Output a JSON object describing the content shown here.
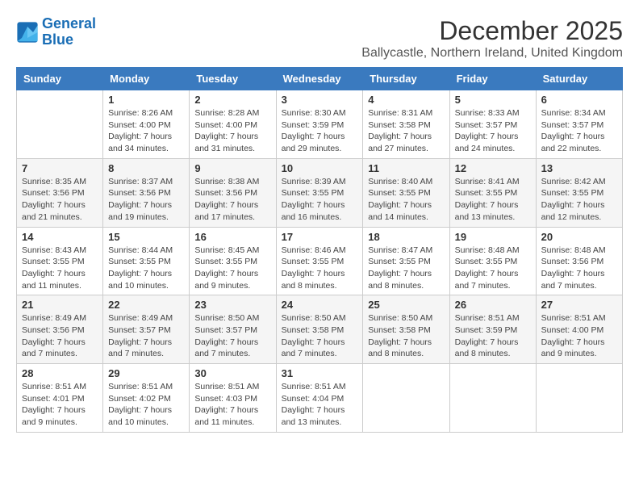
{
  "logo": {
    "line1": "General",
    "line2": "Blue"
  },
  "title": "December 2025",
  "location": "Ballycastle, Northern Ireland, United Kingdom",
  "days_of_week": [
    "Sunday",
    "Monday",
    "Tuesday",
    "Wednesday",
    "Thursday",
    "Friday",
    "Saturday"
  ],
  "weeks": [
    [
      {
        "day": "",
        "sunrise": "",
        "sunset": "",
        "daylight": ""
      },
      {
        "day": "1",
        "sunrise": "Sunrise: 8:26 AM",
        "sunset": "Sunset: 4:00 PM",
        "daylight": "Daylight: 7 hours and 34 minutes."
      },
      {
        "day": "2",
        "sunrise": "Sunrise: 8:28 AM",
        "sunset": "Sunset: 4:00 PM",
        "daylight": "Daylight: 7 hours and 31 minutes."
      },
      {
        "day": "3",
        "sunrise": "Sunrise: 8:30 AM",
        "sunset": "Sunset: 3:59 PM",
        "daylight": "Daylight: 7 hours and 29 minutes."
      },
      {
        "day": "4",
        "sunrise": "Sunrise: 8:31 AM",
        "sunset": "Sunset: 3:58 PM",
        "daylight": "Daylight: 7 hours and 27 minutes."
      },
      {
        "day": "5",
        "sunrise": "Sunrise: 8:33 AM",
        "sunset": "Sunset: 3:57 PM",
        "daylight": "Daylight: 7 hours and 24 minutes."
      },
      {
        "day": "6",
        "sunrise": "Sunrise: 8:34 AM",
        "sunset": "Sunset: 3:57 PM",
        "daylight": "Daylight: 7 hours and 22 minutes."
      }
    ],
    [
      {
        "day": "7",
        "sunrise": "Sunrise: 8:35 AM",
        "sunset": "Sunset: 3:56 PM",
        "daylight": "Daylight: 7 hours and 21 minutes."
      },
      {
        "day": "8",
        "sunrise": "Sunrise: 8:37 AM",
        "sunset": "Sunset: 3:56 PM",
        "daylight": "Daylight: 7 hours and 19 minutes."
      },
      {
        "day": "9",
        "sunrise": "Sunrise: 8:38 AM",
        "sunset": "Sunset: 3:56 PM",
        "daylight": "Daylight: 7 hours and 17 minutes."
      },
      {
        "day": "10",
        "sunrise": "Sunrise: 8:39 AM",
        "sunset": "Sunset: 3:55 PM",
        "daylight": "Daylight: 7 hours and 16 minutes."
      },
      {
        "day": "11",
        "sunrise": "Sunrise: 8:40 AM",
        "sunset": "Sunset: 3:55 PM",
        "daylight": "Daylight: 7 hours and 14 minutes."
      },
      {
        "day": "12",
        "sunrise": "Sunrise: 8:41 AM",
        "sunset": "Sunset: 3:55 PM",
        "daylight": "Daylight: 7 hours and 13 minutes."
      },
      {
        "day": "13",
        "sunrise": "Sunrise: 8:42 AM",
        "sunset": "Sunset: 3:55 PM",
        "daylight": "Daylight: 7 hours and 12 minutes."
      }
    ],
    [
      {
        "day": "14",
        "sunrise": "Sunrise: 8:43 AM",
        "sunset": "Sunset: 3:55 PM",
        "daylight": "Daylight: 7 hours and 11 minutes."
      },
      {
        "day": "15",
        "sunrise": "Sunrise: 8:44 AM",
        "sunset": "Sunset: 3:55 PM",
        "daylight": "Daylight: 7 hours and 10 minutes."
      },
      {
        "day": "16",
        "sunrise": "Sunrise: 8:45 AM",
        "sunset": "Sunset: 3:55 PM",
        "daylight": "Daylight: 7 hours and 9 minutes."
      },
      {
        "day": "17",
        "sunrise": "Sunrise: 8:46 AM",
        "sunset": "Sunset: 3:55 PM",
        "daylight": "Daylight: 7 hours and 8 minutes."
      },
      {
        "day": "18",
        "sunrise": "Sunrise: 8:47 AM",
        "sunset": "Sunset: 3:55 PM",
        "daylight": "Daylight: 7 hours and 8 minutes."
      },
      {
        "day": "19",
        "sunrise": "Sunrise: 8:48 AM",
        "sunset": "Sunset: 3:55 PM",
        "daylight": "Daylight: 7 hours and 7 minutes."
      },
      {
        "day": "20",
        "sunrise": "Sunrise: 8:48 AM",
        "sunset": "Sunset: 3:56 PM",
        "daylight": "Daylight: 7 hours and 7 minutes."
      }
    ],
    [
      {
        "day": "21",
        "sunrise": "Sunrise: 8:49 AM",
        "sunset": "Sunset: 3:56 PM",
        "daylight": "Daylight: 7 hours and 7 minutes."
      },
      {
        "day": "22",
        "sunrise": "Sunrise: 8:49 AM",
        "sunset": "Sunset: 3:57 PM",
        "daylight": "Daylight: 7 hours and 7 minutes."
      },
      {
        "day": "23",
        "sunrise": "Sunrise: 8:50 AM",
        "sunset": "Sunset: 3:57 PM",
        "daylight": "Daylight: 7 hours and 7 minutes."
      },
      {
        "day": "24",
        "sunrise": "Sunrise: 8:50 AM",
        "sunset": "Sunset: 3:58 PM",
        "daylight": "Daylight: 7 hours and 7 minutes."
      },
      {
        "day": "25",
        "sunrise": "Sunrise: 8:50 AM",
        "sunset": "Sunset: 3:58 PM",
        "daylight": "Daylight: 7 hours and 8 minutes."
      },
      {
        "day": "26",
        "sunrise": "Sunrise: 8:51 AM",
        "sunset": "Sunset: 3:59 PM",
        "daylight": "Daylight: 7 hours and 8 minutes."
      },
      {
        "day": "27",
        "sunrise": "Sunrise: 8:51 AM",
        "sunset": "Sunset: 4:00 PM",
        "daylight": "Daylight: 7 hours and 9 minutes."
      }
    ],
    [
      {
        "day": "28",
        "sunrise": "Sunrise: 8:51 AM",
        "sunset": "Sunset: 4:01 PM",
        "daylight": "Daylight: 7 hours and 9 minutes."
      },
      {
        "day": "29",
        "sunrise": "Sunrise: 8:51 AM",
        "sunset": "Sunset: 4:02 PM",
        "daylight": "Daylight: 7 hours and 10 minutes."
      },
      {
        "day": "30",
        "sunrise": "Sunrise: 8:51 AM",
        "sunset": "Sunset: 4:03 PM",
        "daylight": "Daylight: 7 hours and 11 minutes."
      },
      {
        "day": "31",
        "sunrise": "Sunrise: 8:51 AM",
        "sunset": "Sunset: 4:04 PM",
        "daylight": "Daylight: 7 hours and 13 minutes."
      },
      {
        "day": "",
        "sunrise": "",
        "sunset": "",
        "daylight": ""
      },
      {
        "day": "",
        "sunrise": "",
        "sunset": "",
        "daylight": ""
      },
      {
        "day": "",
        "sunrise": "",
        "sunset": "",
        "daylight": ""
      }
    ]
  ]
}
